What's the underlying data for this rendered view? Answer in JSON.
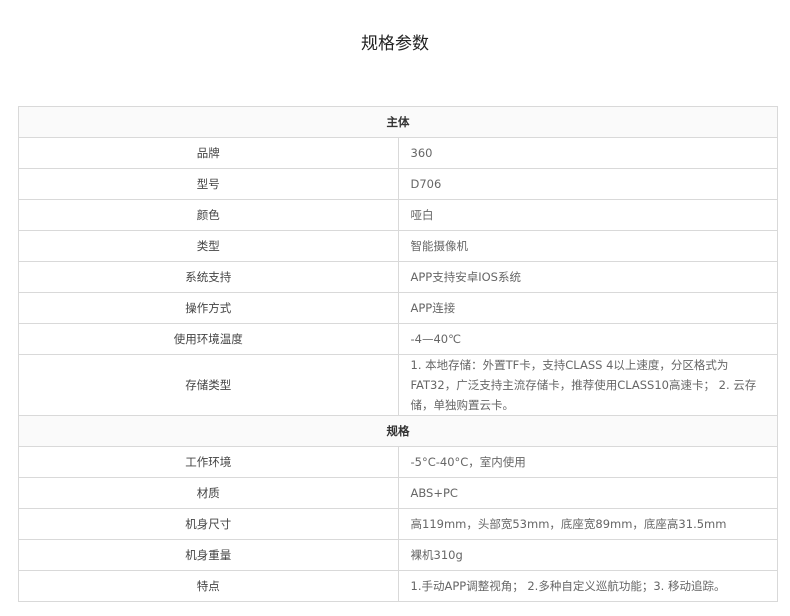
{
  "page": {
    "title": "规格参数"
  },
  "sections": [
    {
      "header": "主体",
      "rows": [
        {
          "key": "品牌",
          "value": "360"
        },
        {
          "key": "型号",
          "value": "D706"
        },
        {
          "key": "颜色",
          "value": "哑白"
        },
        {
          "key": "类型",
          "value": "智能摄像机"
        },
        {
          "key": "系统支持",
          "value": "APP支持安卓IOS系统"
        },
        {
          "key": "操作方式",
          "value": "APP连接"
        },
        {
          "key": "使用环境温度",
          "value": "-4—40℃"
        },
        {
          "key": "存储类型",
          "value": "1. 本地存储：外置TF卡，支持CLASS 4以上速度，分区格式为FAT32，广泛支持主流存储卡，推荐使用CLASS10高速卡； 2. 云存储，单独购置云卡。"
        }
      ]
    },
    {
      "header": "规格",
      "rows": [
        {
          "key": "工作环境",
          "value": "-5°C-40°C，室内使用"
        },
        {
          "key": "材质",
          "value": "ABS+PC"
        },
        {
          "key": "机身尺寸",
          "value": "高119mm，头部宽53mm，底座宽89mm，底座高31.5mm"
        },
        {
          "key": "机身重量",
          "value": "裸机310g"
        },
        {
          "key": "特点",
          "value": "1.手动APP调整视角； 2.多种自定义巡航功能；3. 移动追踪。"
        }
      ]
    }
  ]
}
